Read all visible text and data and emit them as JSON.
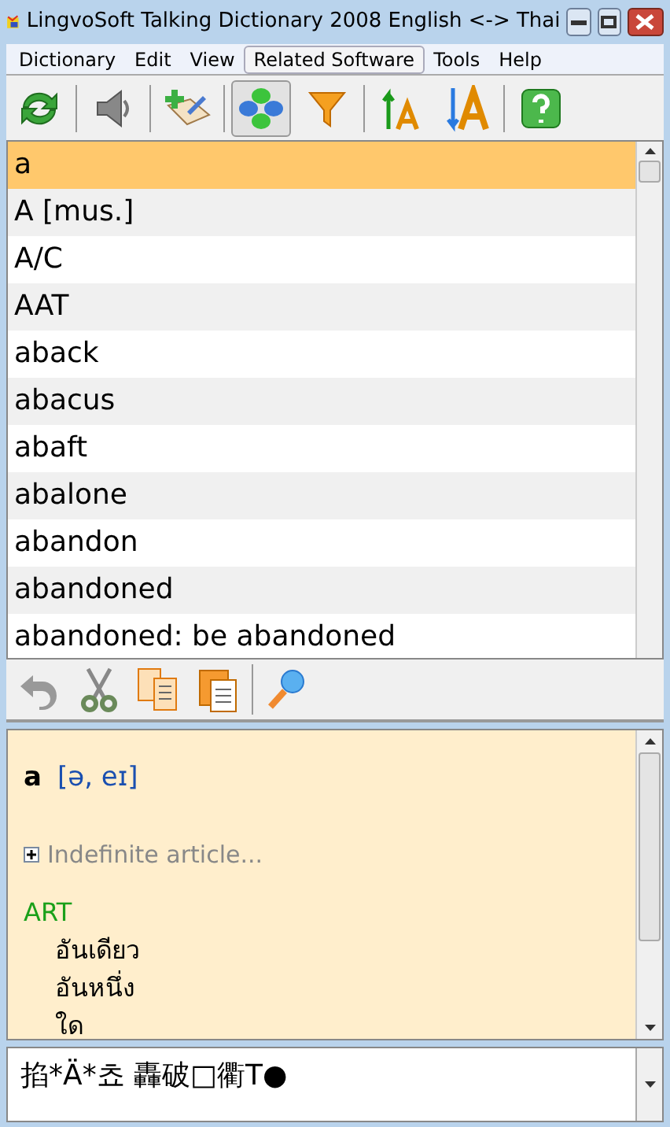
{
  "window": {
    "title": "LingvoSoft Talking Dictionary 2008 English <-> Thai"
  },
  "menu": [
    {
      "label": "Dictionary",
      "selected": false
    },
    {
      "label": "Edit",
      "selected": false
    },
    {
      "label": "View",
      "selected": false
    },
    {
      "label": "Related Software",
      "selected": true
    },
    {
      "label": "Tools",
      "selected": false
    },
    {
      "label": "Help",
      "selected": false
    }
  ],
  "toolbar": [
    {
      "kind": "refresh",
      "selected": false
    },
    {
      "kind": "speaker",
      "selected": false
    },
    {
      "kind": "add",
      "selected": false
    },
    {
      "kind": "diamonds",
      "selected": true
    },
    {
      "kind": "filter",
      "selected": false
    },
    {
      "kind": "font-up",
      "selected": false
    },
    {
      "kind": "font-down",
      "selected": false
    },
    {
      "kind": "help",
      "selected": false
    }
  ],
  "word_list": [
    {
      "label": "a",
      "selected": true
    },
    {
      "label": "A [mus.]",
      "selected": false
    },
    {
      "label": "A/C",
      "selected": false
    },
    {
      "label": "AAT",
      "selected": false
    },
    {
      "label": "aback",
      "selected": false
    },
    {
      "label": "abacus",
      "selected": false
    },
    {
      "label": "abaft",
      "selected": false
    },
    {
      "label": "abalone",
      "selected": false
    },
    {
      "label": "abandon",
      "selected": false
    },
    {
      "label": "abandoned",
      "selected": false
    },
    {
      "label": "abandoned: be abandoned",
      "selected": false
    }
  ],
  "edit_toolbar": [
    {
      "kind": "undo"
    },
    {
      "kind": "cut"
    },
    {
      "kind": "copy"
    },
    {
      "kind": "paste"
    },
    {
      "kind": "search"
    }
  ],
  "article": {
    "headword": "a",
    "transcription": "[ə, eɪ]",
    "note": "Indefinite article...",
    "part_of_speech": "ART",
    "translations": [
      "อันเดียว",
      "อันหนึ่ง",
      "ใด"
    ]
  },
  "input": {
    "value": "掐*Ä*쵸 轟破□衢T●"
  }
}
